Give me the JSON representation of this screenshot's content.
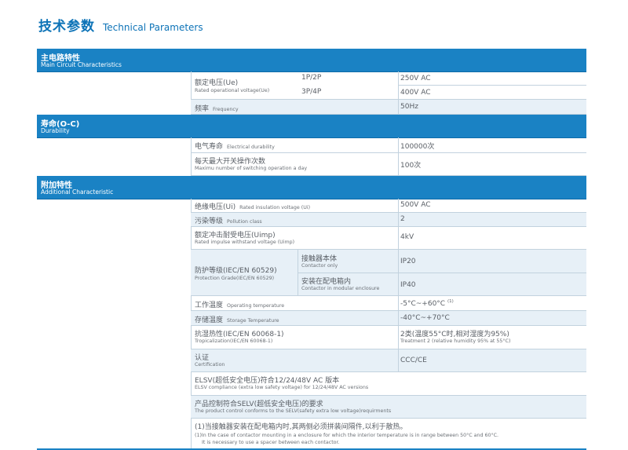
{
  "title": {
    "cn": "技术参数",
    "en": "Technical Parameters"
  },
  "sections": {
    "main": {
      "cn": "主电路特性",
      "en": "Main Circuit Characteristics"
    },
    "durability": {
      "cn": "寿命(O-C)",
      "en": "Durability"
    },
    "additional": {
      "cn": "附加特性",
      "en": "Additional Characteristic"
    }
  },
  "main": {
    "rated_voltage": {
      "cn": "额定电压(Ue)",
      "en": "Rated operational voltage(Ue)",
      "p12": "1P/2P",
      "p12_value": "250V AC",
      "p34": "3P/4P",
      "p34_value": "400V AC"
    },
    "frequency": {
      "cn": "频率",
      "en": "Frequency",
      "value": "50Hz"
    }
  },
  "durability": {
    "electrical": {
      "cn": "电气寿命",
      "en": "Electrical durability",
      "value": "100000次"
    },
    "switching": {
      "cn": "每天最大开关操作次数",
      "en": "Maximu number of switching operation a day",
      "value": "100次"
    }
  },
  "additional": {
    "insulation": {
      "cn": "绝缘电压(Ui)",
      "en": "Rated insulation voltage (Ui)",
      "value": "500V AC"
    },
    "pollution": {
      "cn": "污染等级",
      "en": "Pollution class",
      "value": "2"
    },
    "impulse": {
      "cn": "额定冲击耐受电压(Uimp)",
      "en": "Rated impulse withstand voltage (Uimp)",
      "value": "4kV"
    },
    "protection": {
      "cn": "防护等级(IEC/EN 60529)",
      "en": "Protection Grade(IEC/EN 60529)",
      "contactor_cn": "接触器本体",
      "contactor_en": "Contactor only",
      "contactor_value": "IP20",
      "enclosure_cn": "安装在配电箱内",
      "enclosure_en": "Contactor in modular enclosure",
      "enclosure_value": "IP40"
    },
    "operating_temp": {
      "cn": "工作温度",
      "en": "Operating temperature",
      "value": "-5°C~+60°C",
      "note": "(1)"
    },
    "storage_temp": {
      "cn": "存储温度",
      "en": "Storage Temperature",
      "value": "-40°C~+70°C"
    },
    "tropicalization": {
      "cn": "抗湿热性(IEC/EN 60068-1)",
      "en": "Tropicalization(IEC/EN 60068-1)",
      "value_cn": "2类(温度55°C时,相对湿度为95%)",
      "value_en": "Treatment 2 (relative humidity 95% at 55°C)"
    },
    "certification": {
      "cn": "认证",
      "en": "Certification",
      "value": "CCC/CE"
    },
    "elsv": {
      "cn": "ELSV(超低安全电压)符合12/24/48V AC 版本",
      "en": "ELSV compliance (extra low safety voltage) for 12/24/48V AC versions"
    },
    "selv": {
      "cn": "产品控制符合SELV(超低安全电压)的要求",
      "en": "The product control conforms to the SELV(safety extra low voltage)requirments"
    },
    "footnote": {
      "cn": "(1)当接触器安装在配电箱内时,其两侧必须拼装间隔件,以利于散热。",
      "en1": "(1)In the case of contactor mounting in a enclosure for which the interior temperature is in range between 50°C and 60°C.",
      "en2": "It is necessary to use a spacer between each contactor."
    }
  },
  "colors": {
    "accent": "#1a82c4",
    "shade": "#e7f0f7",
    "grid": "#c2d2de"
  }
}
